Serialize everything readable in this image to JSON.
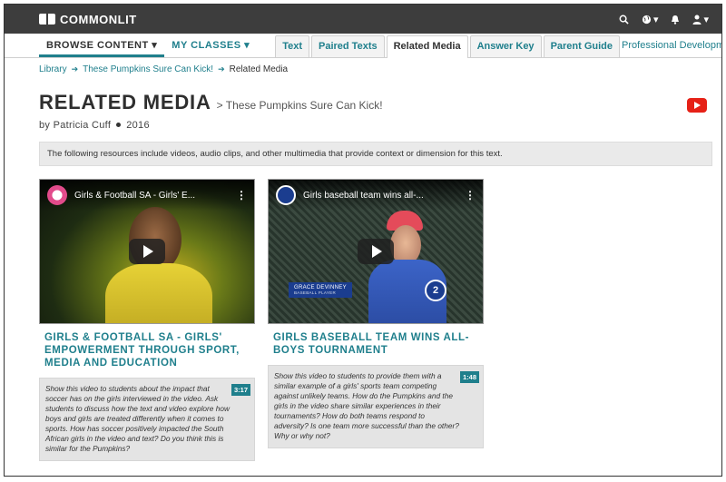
{
  "app": {
    "logo": "COMMONLIT"
  },
  "topbar": {
    "icons": [
      "search-icon",
      "globe-icon",
      "bell-icon",
      "user-icon"
    ]
  },
  "nav": {
    "browse": "BROWSE CONTENT ▾",
    "classes": "MY CLASSES ▾",
    "tabs": [
      {
        "label": "Text"
      },
      {
        "label": "Paired Texts"
      },
      {
        "label": "Related Media",
        "active": true
      },
      {
        "label": "Answer Key"
      },
      {
        "label": "Parent Guide"
      }
    ],
    "pd_portal": "Professional Development Portal"
  },
  "breadcrumb": {
    "library": "Library",
    "text": "These Pumpkins Sure Can Kick!",
    "current": "Related Media"
  },
  "page": {
    "title": "RELATED MEDIA",
    "subtitle": "> These Pumpkins Sure Can Kick!",
    "author": "by Patricia Cuff",
    "year": "2016",
    "info": "The following resources include videos, audio clips, and other multimedia that provide context or dimension for this text."
  },
  "cards": [
    {
      "video_title": "Girls & Football SA - Girls' E...",
      "title": "GIRLS & FOOTBALL SA - GIRLS' EMPOWERMENT THROUGH SPORT, MEDIA AND EDUCATION",
      "description": "Show this video to students about the impact that soccer has on the girls interviewed in the video. Ask students to discuss how the text and video explore how boys and girls are treated differently when it comes to sports. How has soccer positively impacted the South African girls in the video and text? Do you think this is similar for the Pumpkins?",
      "duration": "3:17"
    },
    {
      "video_title": "Girls baseball team wins all-...",
      "title": "GIRLS BASEBALL TEAM WINS ALL-BOYS TOURNAMENT",
      "description": "Show this video to students to provide them with a similar example of a girls' sports team competing against unlikely teams. How do the Pumpkins and the girls in the video share similar experiences in their tournaments? How do both teams respond to adversity? Is one team more successful than the other? Why or why not?",
      "duration": "1:48",
      "lower_third_name": "GRACE DEVINNEY",
      "lower_third_sub": "BASEBALL PLAYER",
      "channel_bug": "2"
    }
  ],
  "colors": {
    "accent": "#1f7f8c",
    "topbar": "#3d3d3d",
    "youtube": "#e62117"
  }
}
